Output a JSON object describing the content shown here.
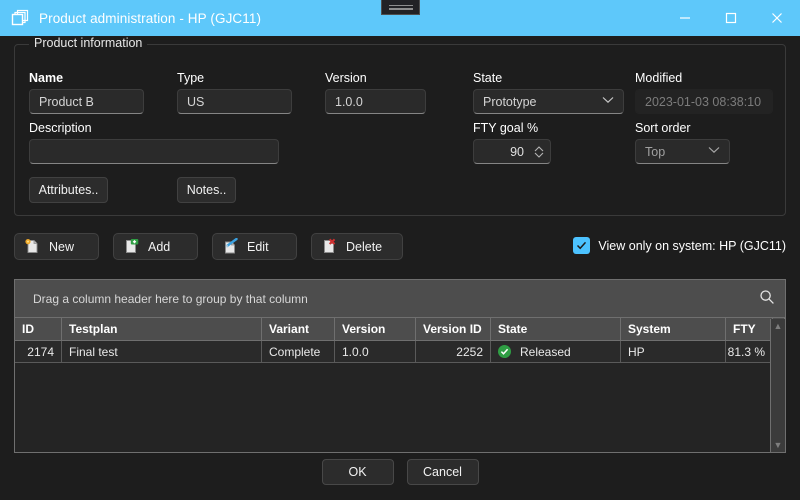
{
  "window": {
    "title": "Product administration - HP (GJC11)",
    "icon": "stacked-windows-icon",
    "accent_color": "#5ec8fa",
    "minimize_label": "Minimize",
    "maximize_label": "Maximize",
    "close_label": "Close"
  },
  "product_information": {
    "legend": "Product information",
    "fields": {
      "name": {
        "label": "Name",
        "value": "Product B"
      },
      "type": {
        "label": "Type",
        "value": "US"
      },
      "version": {
        "label": "Version",
        "value": "1.0.0"
      },
      "state": {
        "label": "State",
        "value": "Prototype"
      },
      "modified": {
        "label": "Modified",
        "value": "2023-01-03 08:38:10"
      },
      "description": {
        "label": "Description",
        "value": ""
      },
      "fty_goal": {
        "label": "FTY goal %",
        "value": "90"
      },
      "sort_order": {
        "label": "Sort order",
        "value": "Top"
      }
    },
    "buttons": {
      "attributes": "Attributes..",
      "notes": "Notes.."
    }
  },
  "toolbar": {
    "new_label": "New",
    "add_label": "Add",
    "edit_label": "Edit",
    "delete_label": "Delete",
    "view_only_label": "View only on system: HP (GJC11)",
    "view_only_checked": "✓"
  },
  "grid": {
    "group_hint": "Drag a column header here to group by that column",
    "search_icon": "search-icon",
    "columns": [
      "ID",
      "Testplan",
      "Variant",
      "Version",
      "Version ID",
      "State",
      "System",
      "FTY"
    ],
    "rows": [
      {
        "id": "2174",
        "testplan": "Final test",
        "variant": "Complete",
        "version": "1.0.0",
        "version_id": "2252",
        "state": "Released",
        "state_color": "#2f9e44",
        "system": "HP",
        "fty": "81.3 %"
      }
    ],
    "scroll_up": "▲",
    "scroll_down": "▼"
  },
  "footer": {
    "ok_label": "OK",
    "cancel_label": "Cancel"
  }
}
